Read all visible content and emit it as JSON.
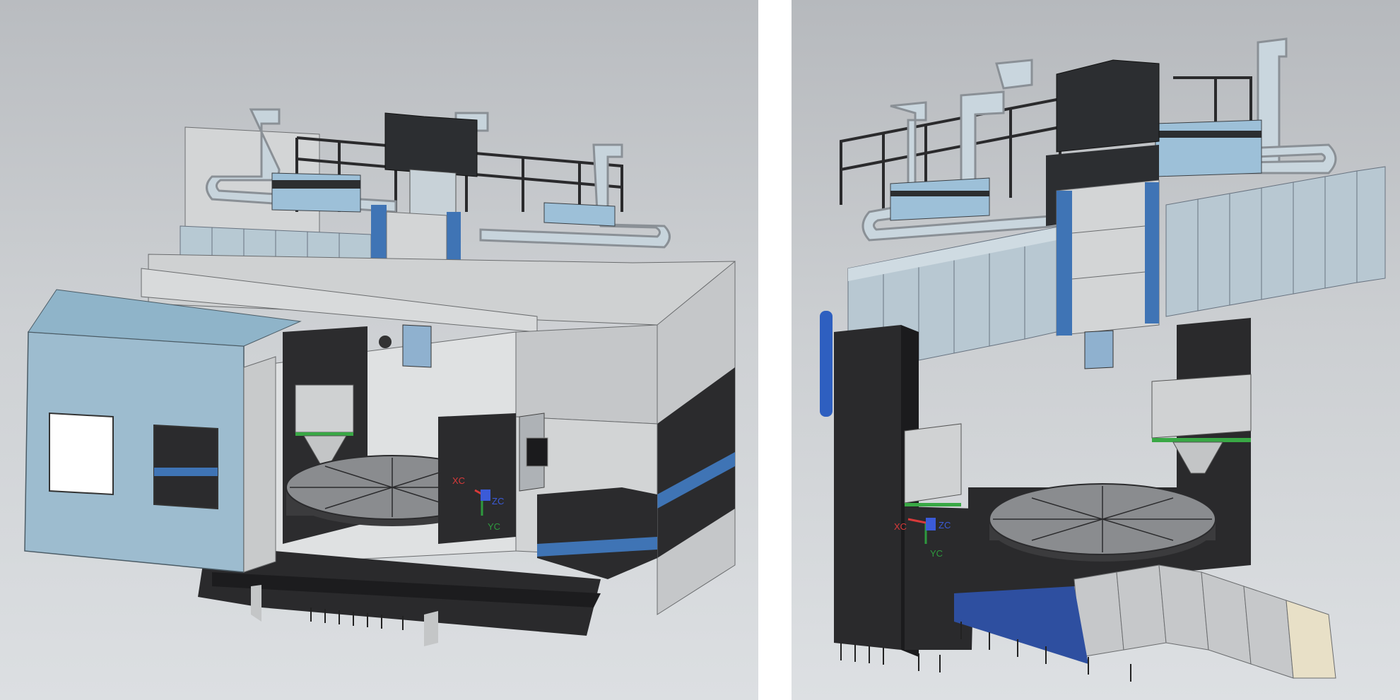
{
  "views": [
    {
      "id": "enclosed-view",
      "triad": {
        "x": "XC",
        "y": "YC",
        "z": "ZC"
      }
    },
    {
      "id": "open-gantry-view",
      "triad": {
        "x": "XC",
        "y": "YC",
        "z": "ZC"
      }
    }
  ],
  "colors": {
    "sheet_light": "#c9ccce",
    "sheet_blue": "#8fb4c9",
    "cover_blue": "#a9c3d2",
    "accent_blue": "#3f74b5",
    "dark": "#2a2a2c",
    "green_seal": "#39a845",
    "axis_x": "#d83a3a",
    "axis_y": "#2e9a3e",
    "axis_z": "#3b5bd8"
  }
}
